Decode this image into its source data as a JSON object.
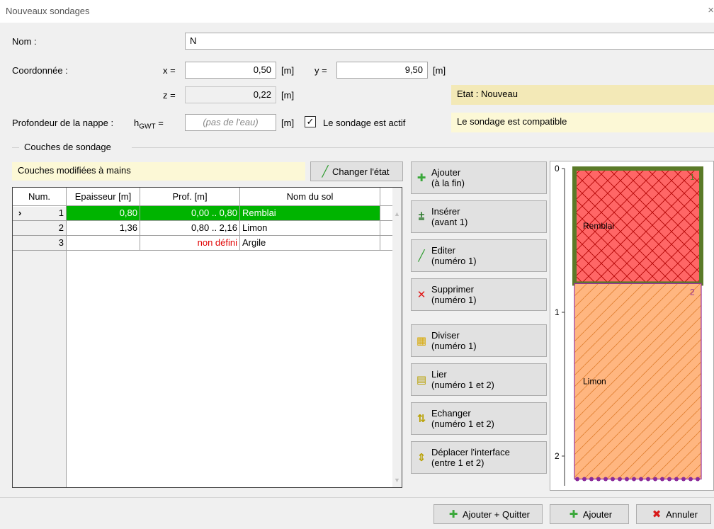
{
  "window": {
    "title": "Nouveaux sondages",
    "close_glyph": "×"
  },
  "form": {
    "name_label": "Nom :",
    "name_value": "N",
    "coord_label": "Coordonnée :",
    "x_label": "x =",
    "x_value": "0,50",
    "y_label": "y =",
    "y_value": "9,50",
    "z_label": "z =",
    "z_value": "0,22",
    "unit_m": "[m]",
    "gwt_label": "Profondeur de la nappe :",
    "gwt_symbol": "h",
    "gwt_sub": "GWT",
    "gwt_eq": "=",
    "gwt_placeholder": "(pas de l'eau)",
    "active_checkbox_label": "Le sondage est actif",
    "active_checked": true,
    "state_text": "Etat : Nouveau",
    "compat_text": "Le sondage est compatible"
  },
  "layers": {
    "group_title": "Couches de sondage",
    "modified_text": "Couches modifiées à mains",
    "change_state_label": "Changer l'état",
    "columns": [
      "Num.",
      "Epaisseur [m]",
      "Prof. [m]",
      "Nom du sol"
    ],
    "rows": [
      {
        "selector": "›",
        "num": "1",
        "thickness": "0,80",
        "depth": "0,00 .. 0,80",
        "soil": "Remblai",
        "active": true
      },
      {
        "selector": "",
        "num": "2",
        "thickness": "1,36",
        "depth": "0,80 .. 2,16",
        "soil": "Limon",
        "active": false
      },
      {
        "selector": "",
        "num": "3",
        "thickness": "",
        "depth": "non défini",
        "soil": "Argile",
        "active": false
      }
    ]
  },
  "actions": [
    {
      "icon": "add-icon",
      "line1": "Ajouter",
      "line2": "(à la fin)"
    },
    {
      "icon": "insert-icon",
      "line1": "Insérer",
      "line2": "(avant 1)"
    },
    {
      "icon": "edit-icon",
      "line1": "Editer",
      "line2": "(numéro 1)"
    },
    {
      "icon": "delete-icon",
      "line1": "Supprimer",
      "line2": "(numéro 1)"
    },
    {
      "icon": "split-icon",
      "line1": "Diviser",
      "line2": "(numéro 1)"
    },
    {
      "icon": "link-icon",
      "line1": "Lier",
      "line2": "(numéro 1 et 2)"
    },
    {
      "icon": "swap-icon",
      "line1": "Echanger",
      "line2": "(numéro 1 et 2)"
    },
    {
      "icon": "move-interface-icon",
      "line1": "Déplacer l'interface",
      "line2": "(entre 1 et 2)"
    }
  ],
  "profile": {
    "depth_ticks": [
      "0",
      "1",
      "2"
    ],
    "layers": [
      {
        "index": "1",
        "name": "Remblai",
        "top": 0.0,
        "bottom": 0.8,
        "fill": "#ff6666",
        "border": "#5a7a28"
      },
      {
        "index": "2",
        "name": "Limon",
        "top": 0.8,
        "bottom": 2.16,
        "fill": "#ffb680",
        "border": "#993399"
      }
    ]
  },
  "footer": {
    "add_quit": "Ajouter + Quitter",
    "add": "Ajouter",
    "cancel": "Annuler"
  },
  "colors": {
    "active_row": "#00b400",
    "highlight_yellow": "#fcf8d6",
    "state_yellow": "#f3e9b7",
    "undefined_text": "#e00000"
  }
}
